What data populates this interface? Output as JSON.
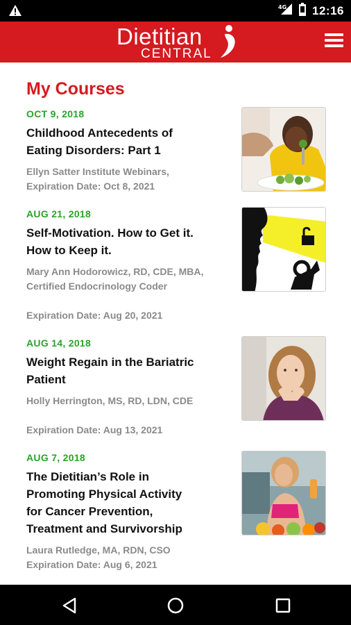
{
  "status_bar": {
    "time": "12:16",
    "icons": [
      "warning-icon",
      "signal-4g-icon",
      "battery-icon"
    ]
  },
  "app_bar": {
    "logo_line1": "Dietitian",
    "logo_line2": "CENTRAL",
    "menu_icon": "hamburger-menu-icon",
    "brand_color": "#d51a20"
  },
  "page_title": "My Courses",
  "courses": [
    {
      "date": "OCT 9, 2018",
      "title": "Childhood Antecedents of Eating Disorders: Part 1",
      "author": "Ellyn Satter Institute Webinars,",
      "expiration": "Expiration Date: Oct 8, 2021",
      "image": "child-eating-vegetables-photo"
    },
    {
      "date": "AUG 21, 2018",
      "title": "Self-Motivation. How to Get it. How to Keep it.",
      "author": "Mary Ann Hodorowicz, RD, CDE, MBA, Certified Endocrinology Coder",
      "expiration": "Expiration Date: Aug 20, 2021",
      "image": "silhouette-unlock-illustration"
    },
    {
      "date": "AUG 14, 2018",
      "title": "Weight Regain in the Bariatric Patient",
      "author": "Holly Herrington, MS, RD, LDN, CDE",
      "expiration": "Expiration Date: Aug 13, 2021",
      "image": "woman-thinking-photo"
    },
    {
      "date": "AUG 7, 2018",
      "title": "The Dietitian’s Role in Promoting Physical Activity for Cancer Prevention, Treatment and Survivorship",
      "author": "Laura Rutledge, MA, RDN, CSO",
      "expiration": "Expiration Date: Aug 6, 2021",
      "image": "woman-fitness-fruit-photo"
    }
  ],
  "nav_bar": {
    "buttons": [
      "back-icon",
      "home-icon",
      "recents-icon"
    ]
  },
  "colors": {
    "accent": "#d51a20",
    "date_green": "#2aa32a",
    "meta_gray": "#8a8a8a"
  }
}
